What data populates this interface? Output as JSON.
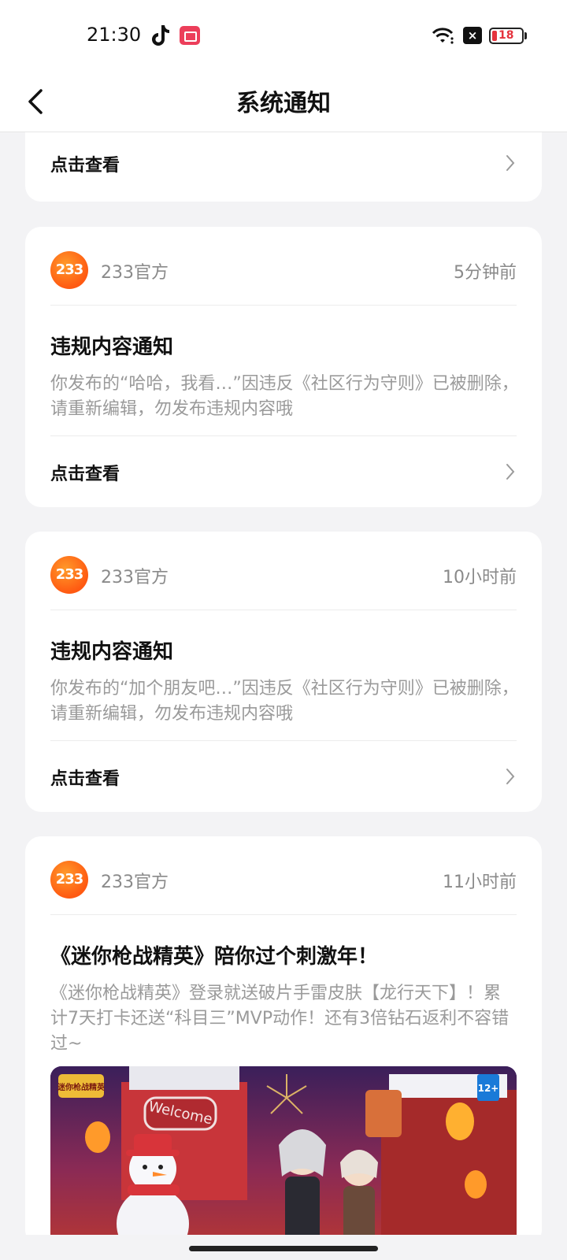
{
  "status": {
    "time": "21:30",
    "battery": "18",
    "icons": [
      "tiktok-icon",
      "screen-record-icon",
      "wifi-icon",
      "x-badge-icon",
      "battery-icon"
    ]
  },
  "nav": {
    "title": "系统通知",
    "back_icon": "chevron-left-icon"
  },
  "top_partial_card": {
    "footer_label": "点击查看"
  },
  "notifications": [
    {
      "avatar": "233",
      "sender": "233官方",
      "time": "5分钟前",
      "title": "违规内容通知",
      "body": "你发布的“哈哈，我看…”因违反《社区行为守则》已被删除，请重新编辑，勿发布违规内容哦",
      "footer_label": "点击查看"
    },
    {
      "avatar": "233",
      "sender": "233官方",
      "time": "10小时前",
      "title": "违规内容通知",
      "body": "你发布的“加个朋友吧…”因违反《社区行为守则》已被删除，请重新编辑，勿发布违规内容哦",
      "footer_label": "点击查看"
    }
  ],
  "promo": {
    "avatar": "233",
    "sender": "233官方",
    "time": "11小时前",
    "title": "《迷你枪战精英》陪你过个刺激年！",
    "body": "《迷你枪战精英》登录就送破片手雷皮肤【龙行天下】！累计7天打卡还送“科目三”MVP动作！还有3倍钻石返利不容错过~",
    "banner": {
      "logo_text": "迷你枪战精英",
      "rating": "12+",
      "sign": "Welcome"
    }
  }
}
